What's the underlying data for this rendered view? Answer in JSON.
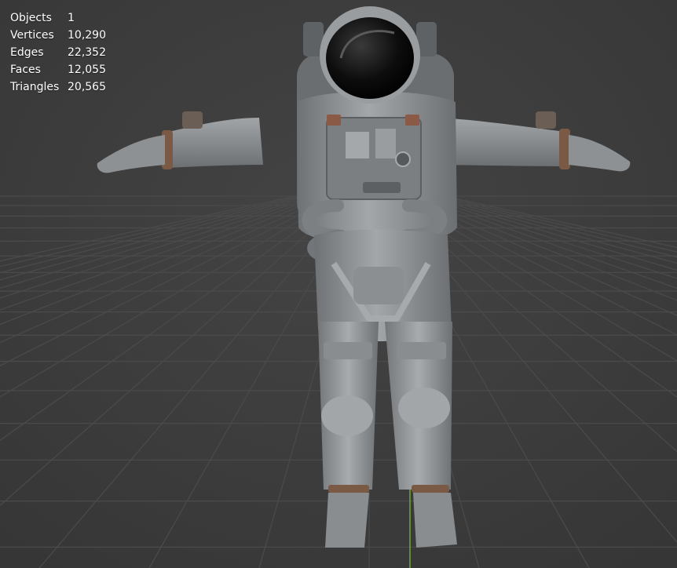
{
  "viewport": {
    "background": "#3d3d3d",
    "grid_color": "#4a4a4a",
    "z_axis_color": "#6fa63a",
    "object_icon": "astronaut-model-icon"
  },
  "stats": {
    "objects": {
      "label": "Objects",
      "value": "1"
    },
    "vertices": {
      "label": "Vertices",
      "value": "10,290"
    },
    "edges": {
      "label": "Edges",
      "value": "22,352"
    },
    "faces": {
      "label": "Faces",
      "value": "12,055"
    },
    "triangles": {
      "label": "Triangles",
      "value": "20,565"
    }
  }
}
